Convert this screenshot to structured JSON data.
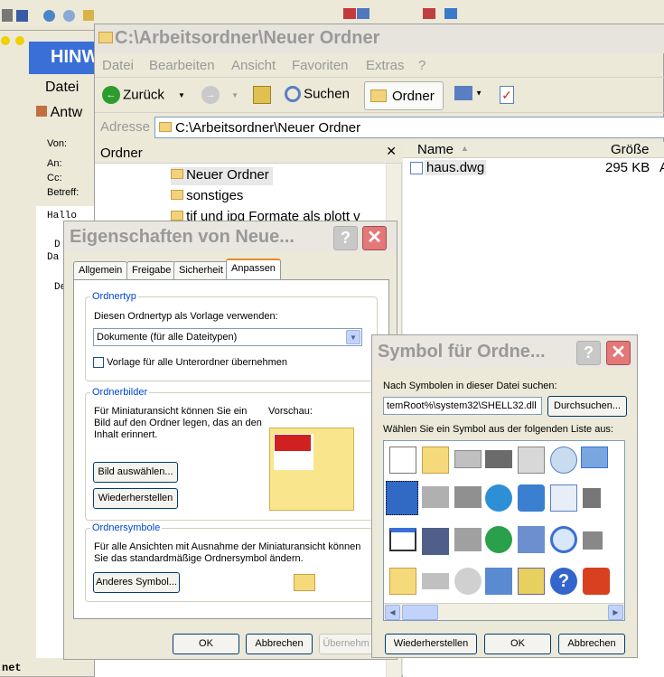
{
  "bg_window": {
    "title_fragment": "HINW",
    "menu_datei": "Datei",
    "antw": "Antw",
    "fields": [
      "Von:",
      "An:",
      "Cc:",
      "Betreff:"
    ],
    "body_lines": [
      "Hallo",
      "D",
      "Da",
      "De"
    ],
    "status_text": "net"
  },
  "explorer": {
    "title": "C:\\Arbeitsordner\\Neuer Ordner",
    "menu": [
      "Datei",
      "Bearbeiten",
      "Ansicht",
      "Favoriten",
      "Extras",
      "?"
    ],
    "back_label": "Zurück",
    "search_label": "Suchen",
    "folders_label": "Ordner",
    "address_label": "Adresse",
    "address_value": "C:\\Arbeitsordner\\Neuer Ordner",
    "folder_pane_title": "Ordner",
    "tree": [
      "Neuer Ordner",
      "sonstiges",
      "tif und jpg Formate als plott v"
    ],
    "columns": [
      "Name",
      "Größe"
    ],
    "files": [
      {
        "name": "haus.dwg",
        "size": "295 KB",
        "extra": "A"
      }
    ]
  },
  "props_dialog": {
    "title": "Eigenschaften von Neue...",
    "tabs": [
      "Allgemein",
      "Freigabe",
      "Sicherheit",
      "Anpassen"
    ],
    "active_tab": "Anpassen",
    "ordnertyp_group": "Ordnertyp",
    "ordnertyp_label": "Diesen Ordnertyp als Vorlage verwenden:",
    "ordnertyp_value": "Dokumente (für alle Dateitypen)",
    "template_checkbox": "Vorlage für alle Unterordner übernehmen",
    "ordnerbilder_group": "Ordnerbilder",
    "ordnerbilder_text": "Für Miniaturansicht können Sie ein Bild auf den Ordner legen, das an den Inhalt erinnert.",
    "vorschau_label": "Vorschau:",
    "bild_button": "Bild auswählen...",
    "restore_button": "Wiederherstellen",
    "ordnersymbole_group": "Ordnersymbole",
    "ordnersymbole_text": "Für alle Ansichten mit Ausnahme der Miniaturansicht können Sie das standardmäßige Ordnersymbol ändern.",
    "other_symbol_button": "Anderes Symbol...",
    "ok": "OK",
    "cancel": "Abbrechen",
    "apply": "Übernehm"
  },
  "symbol_dialog": {
    "title": "Symbol für Ordne...",
    "search_label": "Nach Symbolen in dieser Datei suchen:",
    "path_value": "temRoot%\\system32\\SHELL32.dll",
    "browse_button": "Durchsuchen...",
    "list_label": "Wählen Sie ein Symbol aus der folgenden Liste aus:",
    "restore_button": "Wiederherstellen",
    "ok": "OK",
    "cancel": "Abbrechen"
  }
}
